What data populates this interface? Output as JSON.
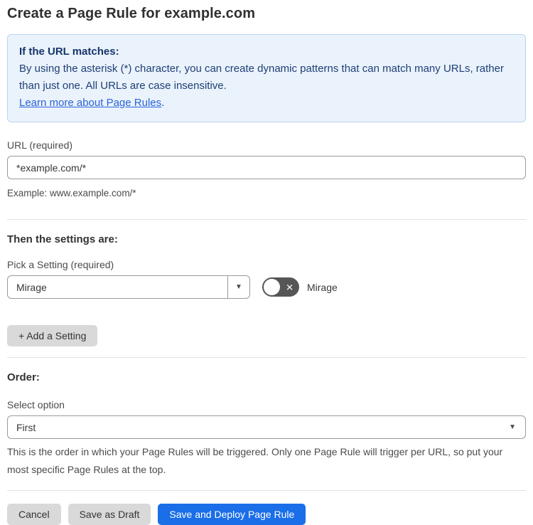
{
  "page": {
    "title": "Create a Page Rule for example.com"
  },
  "info_box": {
    "heading": "If the URL matches:",
    "body": "By using the asterisk (*) character, you can create dynamic patterns that can match many URLs, rather than just one. All URLs are case insensitive.",
    "link_label": "Learn more about Page Rules",
    "link_suffix": "."
  },
  "url_field": {
    "label": "URL (required)",
    "value": "*example.com/*",
    "helper": "Example: www.example.com/*"
  },
  "settings_section": {
    "heading": "Then the settings are:",
    "picker_label": "Pick a Setting (required)",
    "picker_value": "Mirage",
    "toggle_label": "Mirage",
    "toggle_state": "off",
    "add_setting_label": "+ Add a Setting"
  },
  "order_section": {
    "heading": "Order:",
    "select_label": "Select option",
    "select_value": "First",
    "helper": "This is the order in which your Page Rules will be triggered. Only one Page Rule will trigger per URL, so put your most specific Page Rules at the top."
  },
  "footer": {
    "cancel_label": "Cancel",
    "save_draft_label": "Save as Draft",
    "save_deploy_label": "Save and Deploy Page Rule"
  },
  "icons": {
    "dropdown_arrow": "▼",
    "toggle_off_x": "✕"
  },
  "colors": {
    "info_bg": "#eaf2fb",
    "info_border": "#b8d4f1",
    "info_text": "#1e3f77",
    "link_blue": "#2c64d8",
    "primary_button_blue": "#1a6ee8",
    "gray_button": "#d9d9d9",
    "toggle_off_bg": "#565656",
    "input_border": "#9a9a9a",
    "divider": "#e2e2e2"
  }
}
